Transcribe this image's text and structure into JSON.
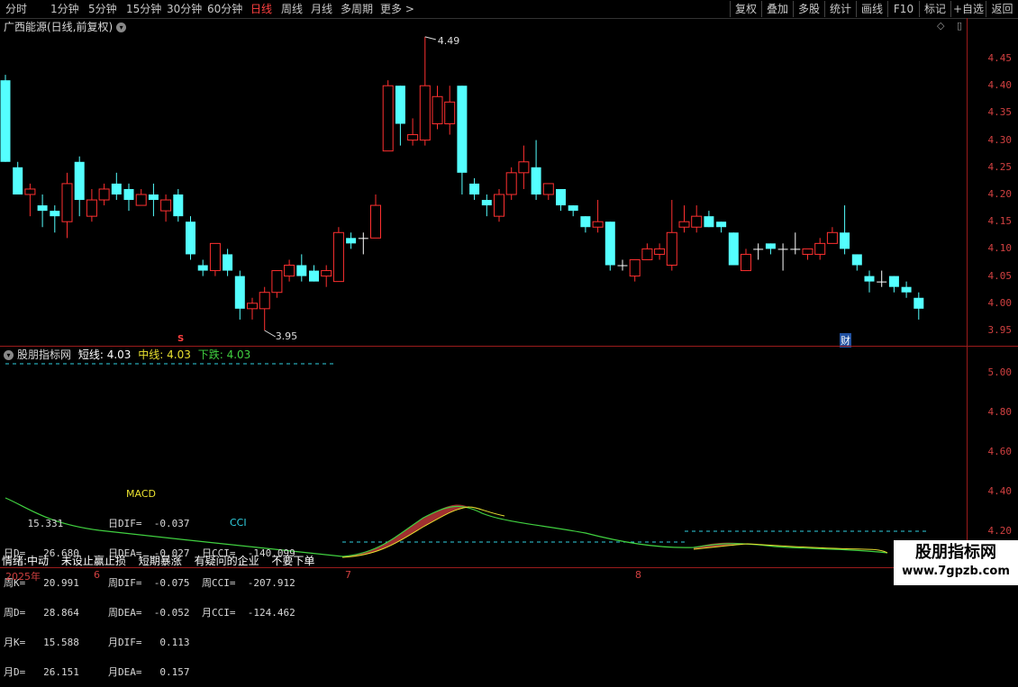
{
  "toolbar": {
    "periods": [
      "分时",
      "1分钟",
      "5分钟",
      "15分钟",
      "30分钟",
      "60分钟",
      "日线",
      "周线",
      "月线",
      "多周期",
      "更多 >"
    ],
    "active_period": "日线",
    "right_buttons": [
      "复权",
      "叠加",
      "多股",
      "统计",
      "画线",
      "F10",
      "标记",
      "+自选",
      "返回"
    ]
  },
  "stock": {
    "title": "广西能源(日线,前复权)"
  },
  "price_axis": [
    "4.45",
    "4.40",
    "4.35",
    "4.30",
    "4.25",
    "4.20",
    "4.15",
    "4.10",
    "4.05",
    "4.00",
    "3.95"
  ],
  "price_markers": {
    "high": "4.49",
    "low": "3.95"
  },
  "event_markers": {
    "s_label": "S",
    "fin_label": "财"
  },
  "indicator": {
    "name": "股朋指标网",
    "short_label": "短线:",
    "short_value": "4.03",
    "mid_label": "中线:",
    "mid_value": "4.03",
    "down_label": "下跌:",
    "down_value": "4.03",
    "axis": [
      "5.00",
      "4.80",
      "4.60",
      "4.40",
      "4.20"
    ]
  },
  "stats": {
    "col1": [
      "    15.331",
      "日D=   26.680",
      "周K=   20.991",
      "周D=   28.864",
      "月K=   15.588",
      "月D=   26.151"
    ],
    "macd_title": "MACD",
    "col2": [
      "日DIF=  -0.037",
      "日DEA=  -0.027",
      "周DIF=  -0.075",
      "周DEA=  -0.052",
      "月DIF=   0.113",
      "月DEA=   0.157"
    ],
    "cci_title": "CCI",
    "col3": [
      "日CCI=  -140.099",
      "周CCI=  -207.912",
      "月CCI=  -124.462"
    ]
  },
  "bottom_tags": [
    "情绪:中动",
    "未设止赢止损",
    "短期暴涨",
    "有疑问的企业",
    "不要下单"
  ],
  "xaxis": {
    "year": "2025年",
    "months": [
      "6",
      "7",
      "8"
    ]
  },
  "watermark": {
    "line1": "股朋指标网",
    "line2": "www.7gpzb.com"
  },
  "colors": {
    "up": "#ff3030",
    "down": "#54ffff",
    "axis": "#9b1b1b"
  },
  "candles": [
    [
      4.41,
      4.26,
      4.42,
      4.26
    ],
    [
      4.25,
      4.2,
      4.26,
      4.2
    ],
    [
      4.2,
      4.21,
      4.22,
      4.16
    ],
    [
      4.18,
      4.17,
      4.2,
      4.14
    ],
    [
      4.17,
      4.16,
      4.18,
      4.13
    ],
    [
      4.15,
      4.22,
      4.24,
      4.12
    ],
    [
      4.26,
      4.19,
      4.27,
      4.16
    ],
    [
      4.16,
      4.19,
      4.21,
      4.15
    ],
    [
      4.19,
      4.21,
      4.22,
      4.18
    ],
    [
      4.22,
      4.2,
      4.24,
      4.19
    ],
    [
      4.21,
      4.19,
      4.22,
      4.17
    ],
    [
      4.18,
      4.2,
      4.21,
      4.18
    ],
    [
      4.2,
      4.19,
      4.22,
      4.16
    ],
    [
      4.17,
      4.19,
      4.2,
      4.15
    ],
    [
      4.2,
      4.16,
      4.21,
      4.15
    ],
    [
      4.15,
      4.09,
      4.16,
      4.08
    ],
    [
      4.07,
      4.06,
      4.08,
      4.05
    ],
    [
      4.06,
      4.11,
      4.11,
      4.05
    ],
    [
      4.09,
      4.06,
      4.1,
      4.05
    ],
    [
      4.05,
      3.99,
      4.06,
      3.97
    ],
    [
      3.99,
      4.0,
      4.01,
      3.97
    ],
    [
      3.99,
      4.02,
      4.03,
      3.95
    ],
    [
      4.02,
      4.06,
      4.06,
      4.01
    ],
    [
      4.05,
      4.07,
      4.08,
      4.04
    ],
    [
      4.07,
      4.05,
      4.09,
      4.04
    ],
    [
      4.06,
      4.04,
      4.07,
      4.04
    ],
    [
      4.05,
      4.06,
      4.07,
      4.03
    ],
    [
      4.04,
      4.13,
      4.14,
      4.04
    ],
    [
      4.12,
      4.11,
      4.13,
      4.1
    ],
    [
      4.12,
      4.12,
      4.13,
      4.09
    ],
    [
      4.12,
      4.18,
      4.2,
      4.12
    ],
    [
      4.28,
      4.4,
      4.41,
      4.28
    ],
    [
      4.4,
      4.33,
      4.4,
      4.29
    ],
    [
      4.3,
      4.31,
      4.34,
      4.29
    ],
    [
      4.3,
      4.4,
      4.49,
      4.29
    ],
    [
      4.33,
      4.38,
      4.4,
      4.32
    ],
    [
      4.33,
      4.37,
      4.4,
      4.31
    ],
    [
      4.4,
      4.24,
      4.4,
      4.2
    ],
    [
      4.22,
      4.2,
      4.23,
      4.19
    ],
    [
      4.19,
      4.18,
      4.2,
      4.16
    ],
    [
      4.16,
      4.2,
      4.21,
      4.15
    ],
    [
      4.2,
      4.24,
      4.25,
      4.19
    ],
    [
      4.24,
      4.26,
      4.29,
      4.21
    ],
    [
      4.25,
      4.2,
      4.3,
      4.19
    ],
    [
      4.2,
      4.22,
      4.22,
      4.19
    ],
    [
      4.21,
      4.18,
      4.21,
      4.17
    ],
    [
      4.18,
      4.17,
      4.18,
      4.16
    ],
    [
      4.16,
      4.14,
      4.16,
      4.13
    ],
    [
      4.14,
      4.15,
      4.19,
      4.13
    ],
    [
      4.15,
      4.07,
      4.15,
      4.06
    ],
    [
      4.07,
      4.07,
      4.08,
      4.06
    ],
    [
      4.05,
      4.08,
      4.08,
      4.04
    ],
    [
      4.08,
      4.1,
      4.11,
      4.08
    ],
    [
      4.09,
      4.1,
      4.11,
      4.08
    ],
    [
      4.07,
      4.13,
      4.19,
      4.06
    ],
    [
      4.14,
      4.15,
      4.18,
      4.13
    ],
    [
      4.14,
      4.16,
      4.18,
      4.13
    ],
    [
      4.16,
      4.14,
      4.17,
      4.14
    ],
    [
      4.15,
      4.14,
      4.15,
      4.13
    ],
    [
      4.13,
      4.07,
      4.13,
      4.07
    ],
    [
      4.06,
      4.09,
      4.1,
      4.06
    ],
    [
      4.1,
      4.1,
      4.11,
      4.08
    ],
    [
      4.11,
      4.1,
      4.11,
      4.09
    ],
    [
      4.1,
      4.1,
      4.11,
      4.06
    ],
    [
      4.1,
      4.1,
      4.13,
      4.09
    ],
    [
      4.09,
      4.1,
      4.1,
      4.08
    ],
    [
      4.09,
      4.11,
      4.12,
      4.08
    ],
    [
      4.11,
      4.13,
      4.14,
      4.11
    ],
    [
      4.13,
      4.1,
      4.18,
      4.09
    ],
    [
      4.09,
      4.07,
      4.09,
      4.06
    ],
    [
      4.05,
      4.04,
      4.06,
      4.02
    ],
    [
      4.04,
      4.04,
      4.06,
      4.03
    ],
    [
      4.05,
      4.03,
      4.05,
      4.02
    ],
    [
      4.03,
      4.02,
      4.04,
      4.01
    ],
    [
      4.01,
      3.99,
      4.02,
      3.97
    ]
  ]
}
